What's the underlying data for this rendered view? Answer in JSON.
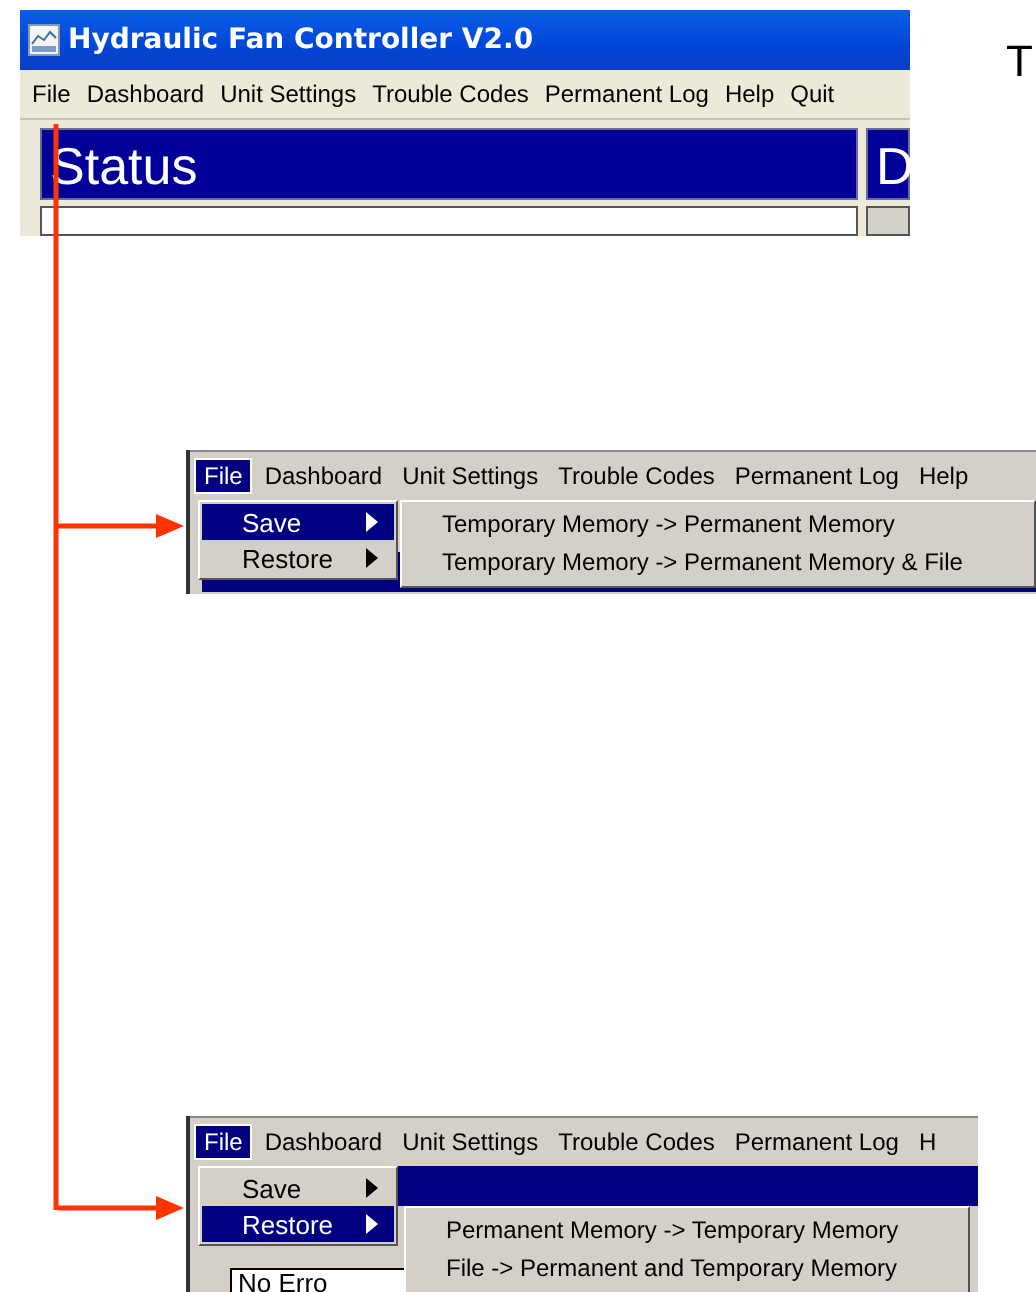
{
  "main_window": {
    "title": "Hydraulic Fan Controller V2.0",
    "menu": [
      {
        "label": "File",
        "selected": false
      },
      {
        "label": "Dashboard",
        "selected": false
      },
      {
        "label": "Unit Settings",
        "selected": false
      },
      {
        "label": "Trouble Codes",
        "selected": false
      },
      {
        "label": "Permanent Log",
        "selected": false
      },
      {
        "label": "Help",
        "selected": false
      },
      {
        "label": "Quit",
        "selected": false
      }
    ],
    "panels": [
      {
        "title": "Status"
      },
      {
        "title": "D"
      }
    ]
  },
  "side_text": "T",
  "menu_shots": [
    {
      "menu": [
        {
          "label": "File",
          "selected": true
        },
        {
          "label": "Dashboard",
          "selected": false
        },
        {
          "label": "Unit Settings",
          "selected": false
        },
        {
          "label": "Trouble Codes",
          "selected": false
        },
        {
          "label": "Permanent Log",
          "selected": false
        },
        {
          "label": "Help",
          "selected": false
        }
      ],
      "file_menu": [
        {
          "label": "Save",
          "selected": true
        },
        {
          "label": "Restore",
          "selected": false
        }
      ],
      "submenu": [
        "Temporary Memory -> Permanent Memory",
        "Temporary Memory -> Permanent Memory & File"
      ]
    },
    {
      "menu": [
        {
          "label": "File",
          "selected": true
        },
        {
          "label": "Dashboard",
          "selected": false
        },
        {
          "label": "Unit Settings",
          "selected": false
        },
        {
          "label": "Trouble Codes",
          "selected": false
        },
        {
          "label": "Permanent Log",
          "selected": false
        },
        {
          "label": "H",
          "selected": false
        }
      ],
      "file_menu": [
        {
          "label": "Save",
          "selected": false
        },
        {
          "label": "Restore",
          "selected": true
        }
      ],
      "submenu": [
        "Permanent Memory -> Temporary Memory",
        "File -> Permanent and Temporary Memory"
      ],
      "body_text": "No Erro"
    }
  ]
}
